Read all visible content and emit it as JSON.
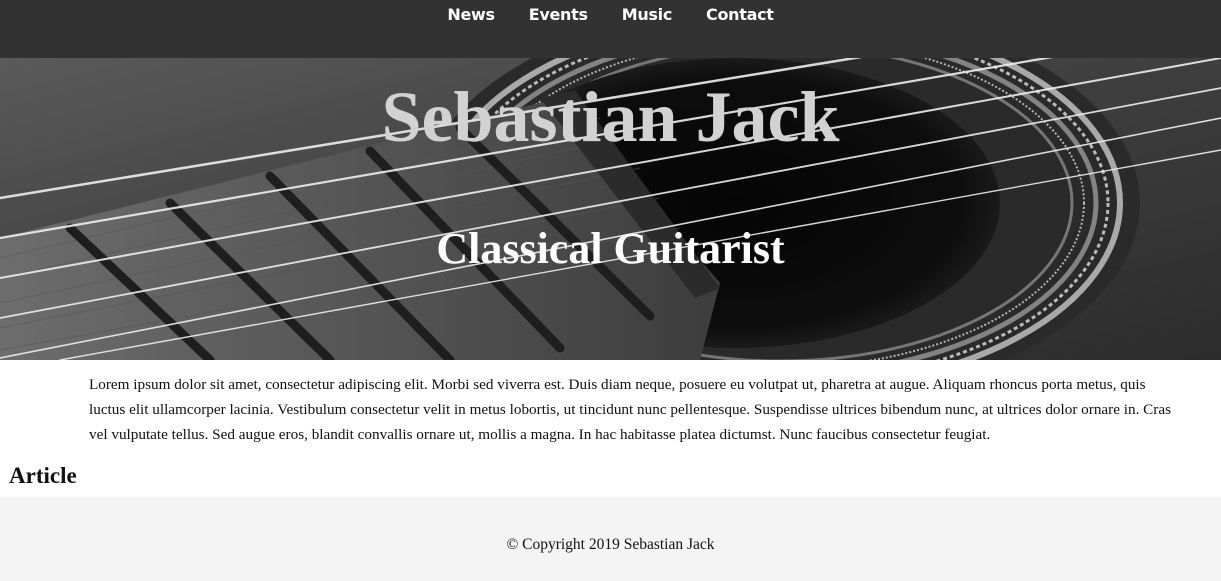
{
  "nav": {
    "items": [
      {
        "label": "News"
      },
      {
        "label": "Events"
      },
      {
        "label": "Music"
      },
      {
        "label": "Contact"
      }
    ]
  },
  "hero": {
    "title": "Sebastian Jack",
    "subtitle": "Classical Guitarist",
    "image_icon": "guitar-closeup-image"
  },
  "main": {
    "intro": "Lorem ipsum dolor sit amet, consectetur adipiscing elit. Morbi sed viverra est. Duis diam neque, posuere eu volutpat ut, pharetra at augue. Aliquam rhoncus porta metus, quis luctus elit ullamcorper lacinia. Vestibulum consectetur velit in metus lobortis, ut tincidunt nunc pellentesque. Suspendisse ultrices bibendum nunc, at ultrices dolor ornare in. Cras vel vulputate tellus. Sed augue eros, blandit convallis ornare ut, mollis a magna. In hac habitasse platea dictumst. Nunc faucibus consectetur feugiat.",
    "article_heading": "Article"
  },
  "footer": {
    "copyright": "© Copyright 2019 Sebastian Jack"
  },
  "colors": {
    "nav_bg": "#323232",
    "footer_bg": "#f4f4f5",
    "title": "#d2d2d2",
    "subtitle": "#ffffff"
  }
}
